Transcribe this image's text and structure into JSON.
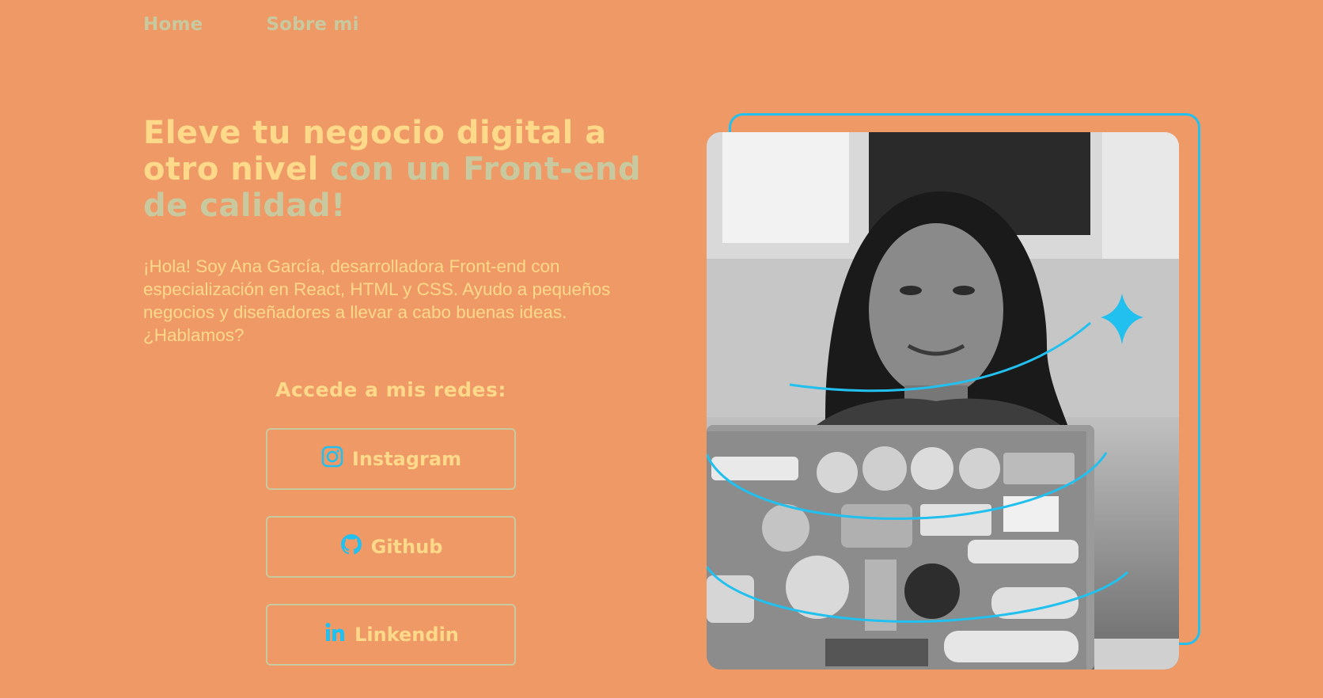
{
  "nav": {
    "home": "Home",
    "about": "Sobre mi"
  },
  "hero": {
    "headline_main": "Eleve tu negocio digital a otro nivel ",
    "headline_accent": "con un Front-end de calidad!",
    "intro": "¡Hola! Soy Ana García, desarrolladora Front-end con especialización en React, HTML y CSS. Ayudo a pequeños negocios y diseñadores a llevar a cabo buenas ideas. ¿Hablamos?",
    "social_title": "Accede a mis redes:",
    "buttons": [
      {
        "label": "Instagram",
        "icon": "instagram-icon"
      },
      {
        "label": "Github",
        "icon": "github-icon"
      },
      {
        "label": "Linkendin",
        "icon": "linkedin-icon"
      }
    ]
  },
  "colors": {
    "background": "#EE9966",
    "headline": "#FFD98A",
    "accent": "#C9C9A0",
    "cyan": "#22C0EE"
  }
}
